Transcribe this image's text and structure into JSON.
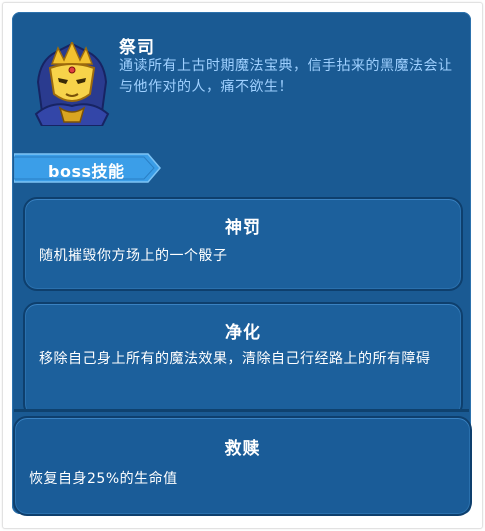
{
  "boss": {
    "name": "祭司",
    "description": "通读所有上古时期魔法宝典，信手拈来的黑魔法会让与他作对的人，痛不欲生！",
    "avatar_icon": "golden-masked-priest-icon"
  },
  "section": {
    "label": "boss技能"
  },
  "skills": [
    {
      "title": "神罚",
      "description": "随机摧毁你方场上的一个骰子"
    },
    {
      "title": "净化",
      "description": "移除自己身上所有的魔法效果，清除自己行经路上的所有障碍"
    },
    {
      "title": "救赎",
      "description": "恢复自身25%的生命值"
    }
  ],
  "colors": {
    "panel_bg": "#1a5a93",
    "card_bg": "#1c609c",
    "accent_text": "#9fd0ff",
    "banner": "#3b9ee8"
  }
}
